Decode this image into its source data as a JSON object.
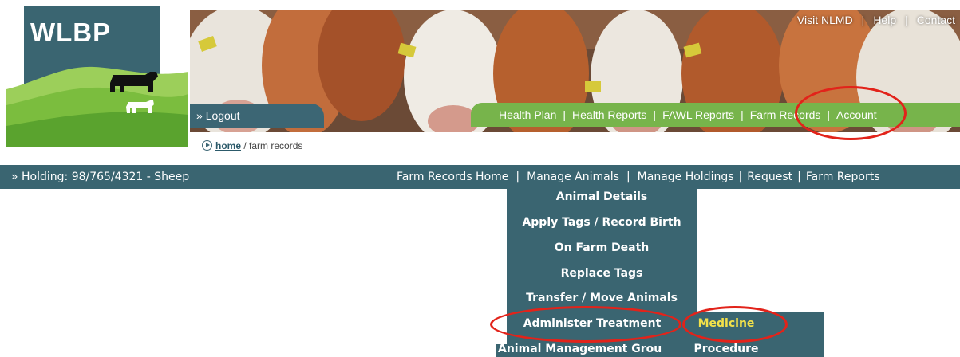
{
  "logo": {
    "text": "WLBP"
  },
  "top_links": [
    "Visit NLMD",
    "Help",
    "Contact"
  ],
  "logout": {
    "label": "Logout"
  },
  "main_nav": [
    "Health Plan",
    "Health Reports",
    "FAWL Reports",
    "Farm Records",
    "Account"
  ],
  "breadcrumb": {
    "home": "home",
    "current": "/ farm records"
  },
  "holding": {
    "label": "» Holding: 98/765/4321 - Sheep"
  },
  "farm_nav": [
    "Farm Records Home",
    "Manage Animals",
    "Manage Holdings",
    "Request",
    "Farm Reports"
  ],
  "manage_animals_menu": [
    "Animal Details",
    "Apply Tags / Record Birth",
    "On Farm Death",
    "Replace Tags",
    "Transfer / Move Animals",
    "Administer Treatment",
    "Animal Management Grou"
  ],
  "treatment_submenu": [
    "Medicine",
    "Procedure"
  ],
  "colors": {
    "teal": "#3a6571",
    "green": "#77b44b",
    "highlight_ring": "#e2231a",
    "highlight_text": "#f2e14a"
  }
}
